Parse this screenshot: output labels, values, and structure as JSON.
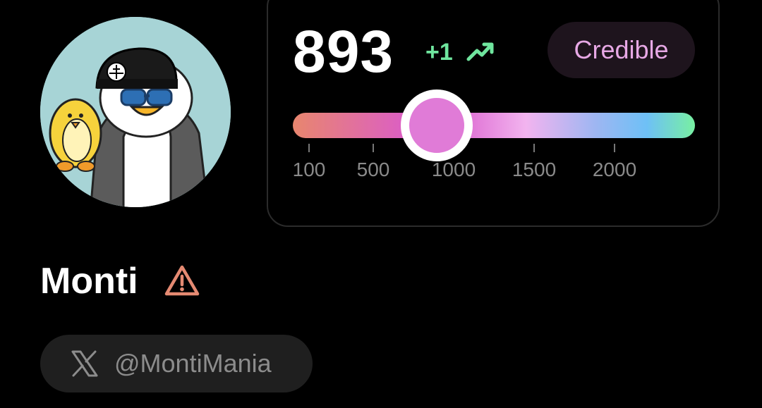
{
  "profile": {
    "name": "Monti",
    "handle": "@MontiMania",
    "avatar_icon": "penguin-avatar-icon",
    "warning_icon": "warning-triangle-icon",
    "social_icon": "x-logo-icon"
  },
  "score_card": {
    "score": "893",
    "delta": "+1",
    "trend_icon": "trending-up-icon",
    "badge": "Credible",
    "slider": {
      "value": 893,
      "ticks": [
        "100",
        "500",
        "1000",
        "1500",
        "2000"
      ]
    }
  },
  "colors": {
    "background": "#000000",
    "positive": "#6fe59e",
    "badge_text": "#e7a8e5",
    "thumb": "#e07bd7",
    "warning": "#e58a72"
  }
}
